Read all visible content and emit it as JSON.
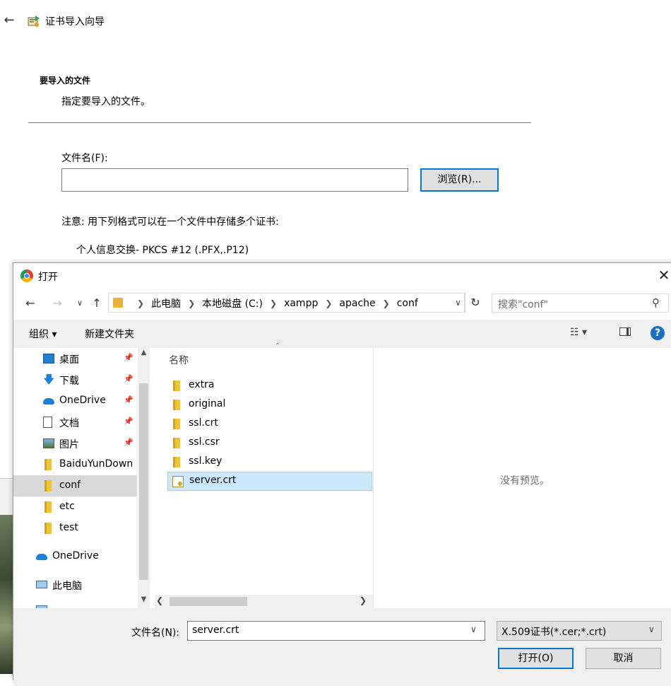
{
  "wizard": {
    "title": "证书导入向导",
    "section_title": "要导入的文件",
    "section_subtitle": "指定要导入的文件。",
    "file_label": "文件名(F):",
    "browse_label": "浏览(R)...",
    "note": "注意: 用下列格式可以在一个文件中存储多个证书:",
    "format_item": "个人信息交换- PKCS #12 (.PFX,.P12)"
  },
  "dialog": {
    "title": "打开",
    "breadcrumbs": [
      "此电脑",
      "本地磁盘 (C:)",
      "xampp",
      "apache",
      "conf"
    ],
    "search_placeholder": "搜索\"conf\"",
    "toolbar": {
      "organize": "组织 ▾",
      "new_folder": "新建文件夹"
    },
    "nav_items": [
      {
        "label": "桌面",
        "icon": "desktop-icon",
        "pinned": true
      },
      {
        "label": "下载",
        "icon": "download-icon",
        "pinned": true
      },
      {
        "label": "OneDrive",
        "icon": "onedrive-icon",
        "pinned": true
      },
      {
        "label": "文档",
        "icon": "document-icon",
        "pinned": true
      },
      {
        "label": "图片",
        "icon": "picture-icon",
        "pinned": true
      },
      {
        "label": "BaiduYunDown",
        "icon": "folder-icon",
        "pinned": false
      },
      {
        "label": "conf",
        "icon": "folder-icon",
        "pinned": false
      },
      {
        "label": "etc",
        "icon": "folder-icon",
        "pinned": false
      },
      {
        "label": "test",
        "icon": "folder-icon",
        "pinned": false
      }
    ],
    "nav_onedrive": "OneDrive",
    "nav_thispc": "此电脑",
    "column_header": "名称",
    "files": [
      {
        "name": "extra",
        "type": "folder"
      },
      {
        "name": "original",
        "type": "folder"
      },
      {
        "name": "ssl.crt",
        "type": "folder"
      },
      {
        "name": "ssl.csr",
        "type": "folder"
      },
      {
        "name": "ssl.key",
        "type": "folder"
      },
      {
        "name": "server.crt",
        "type": "certificate"
      }
    ],
    "preview_text": "没有预览。",
    "filename_label": "文件名(N):",
    "filename_value": "server.crt",
    "filetype_value": "X.509证书(*.cer;*.crt)",
    "open_label": "打开(O)",
    "cancel_label": "取消"
  }
}
